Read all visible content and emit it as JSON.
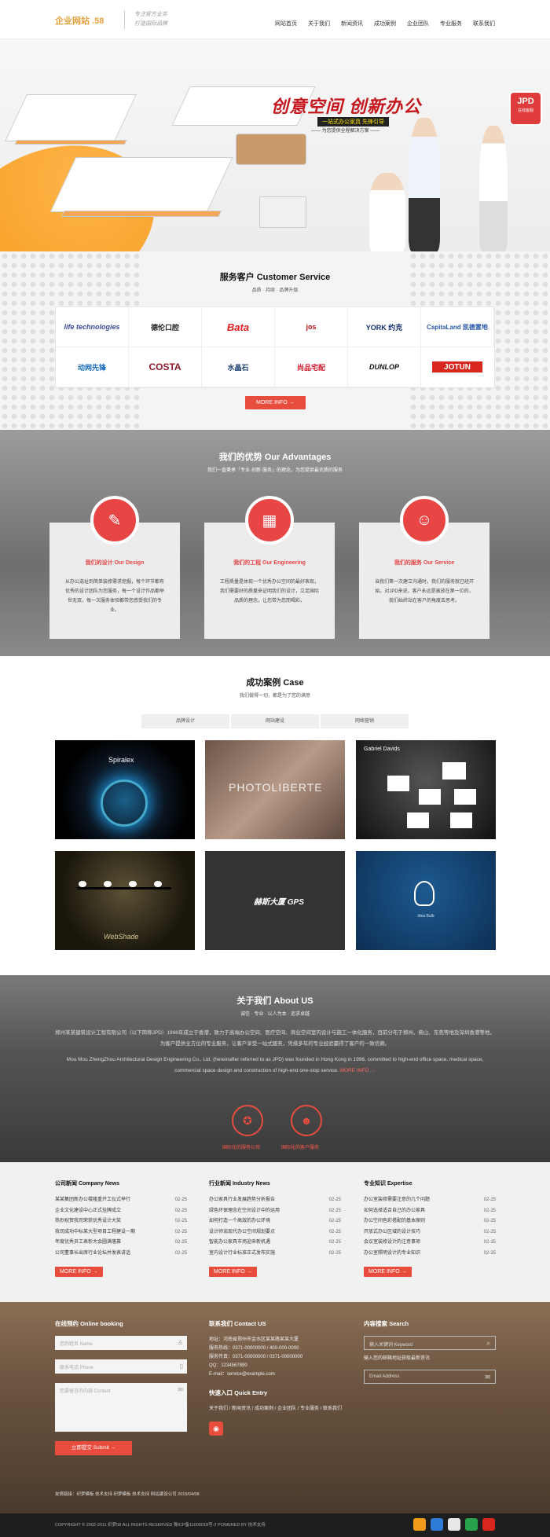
{
  "header": {
    "logo": "企业网站 .58",
    "slogan_line1": "专注官方业务",
    "slogan_line2": "打造国际品牌",
    "nav": [
      "网站首页",
      "关于我们",
      "新闻资讯",
      "成功案例",
      "企业团队",
      "专业服务",
      "联系我们"
    ]
  },
  "banner": {
    "title": "创意空间 创新办公",
    "sub1": "一站式办公家具 先锋引导",
    "sub2": "—— 为您提供全程解决方案 ——",
    "badge": "JPD",
    "badge_sub": "在线客服"
  },
  "customers": {
    "title": "服务客户 Customer Service",
    "subtitle": "品质 · 持续 · 品牌升级",
    "logos": [
      "life technologies",
      "德伦口腔",
      "Bata",
      "jos",
      "YORK 约克",
      "CapitaLand 凯德置地",
      "动网先锋",
      "COSTA",
      "水晶石",
      "尚品宅配",
      "DUNLOP",
      "JOTUN"
    ],
    "more": "MORE INFO →"
  },
  "advantages": {
    "title": "我们的优势 Our Advantages",
    "subtitle": "我们一直秉承「专业·创新·服务」的理念，为您提供最优质的服务",
    "cards": [
      {
        "title": "我们的设计 Our Design",
        "text": "从办公选址到简单装修需求挖掘，每个环节都有优秀的设计团队为您服务，每一个设计作品都举世无双，每一次服务体验都带您感受我们的专业。"
      },
      {
        "title": "我们的工程 Our Engineering",
        "text": "工程质量是体现一个优秀办公空间的最好表现，我们需要好的质量来证明我们的设计，立足国际品质的理念，让您带为您而喝彩。"
      },
      {
        "title": "我们的服务 Our Service",
        "text": "当我们第一次建立沟通时，我们的服务就已经开始，对JPD来说，客户永远是被放在第一位的，我们始终站在客户的角度去思考。"
      }
    ]
  },
  "case": {
    "title": "成功案例 Case",
    "subtitle": "我们做得一切，都是为了您的满意",
    "tabs": [
      "品牌设计",
      "网站建设",
      "网络营销"
    ],
    "items": [
      "Spiralex",
      "PHOTOLIBERTE",
      "Gabriel Davids",
      "WebShade",
      "赫斯大厦 GPS",
      "Idea Bulb"
    ]
  },
  "about": {
    "title": "关于我们 About US",
    "subtitle": "诚信 · 专业 · 以人为本 · 追求卓越",
    "p1": "郑州某某建筑设计工程有限公司（以下简称JPD）1996年成立于香港，致力于高端办公空间、医疗空间、商业空间室内设计与施工一体化服务，目前分布于郑州、佛山、东莞等地及深圳香港等地，为客户提供全方位的专业服务，让客户享受一站式服务，凭借多年的专业经验赢得了客户的一致信赖。",
    "p2": "Mou Mou ZhengZhou Architectural Design Engineering Co., Ltd. (hereinafter referred to as JPD) was founded in Hong Kong in 1996, committed to high-end office space, medical space, commercial space design and construction of high-end one-stop service.",
    "p2_link": "MORE INFO →",
    "icon1": "国际化的服务公司",
    "icon2": "国际化的客户服务"
  },
  "news": {
    "cols": [
      {
        "title": "公司新闻 Company News",
        "items": [
          [
            "某某集团新办公楼隆重开工仪式举行",
            "02-25"
          ],
          [
            "企业文化建设中心正式挂牌成立",
            "02-25"
          ],
          [
            "热烈祝贺我司荣获优秀设计大奖",
            "02-25"
          ],
          [
            "我司成功中标某大型项目工程建设一期",
            "02-25"
          ],
          [
            "年度优秀员工表彰大会圆满落幕",
            "02-25"
          ],
          [
            "公司董事长出席行业论坛并发表讲话",
            "02-25"
          ]
        ]
      },
      {
        "title": "行业新闻 Industry News",
        "items": [
          [
            "办公家具行业发展趋势分析报告",
            "02-25"
          ],
          [
            "绿色环保理念在空间设计中的运用",
            "02-25"
          ],
          [
            "如何打造一个高效的办公环境",
            "02-25"
          ],
          [
            "设计师谈现代办公空间规划要点",
            "02-25"
          ],
          [
            "智能办公家具市场迎来新机遇",
            "02-25"
          ],
          [
            "室内设计行业标准正式发布实施",
            "02-25"
          ]
        ]
      },
      {
        "title": "专业知识 Expertise",
        "items": [
          [
            "办公室装修需要注意的几个问题",
            "02-25"
          ],
          [
            "如何选择适合自己的办公家具",
            "02-25"
          ],
          [
            "办公空间色彩搭配的基本原则",
            "02-25"
          ],
          [
            "开放式办公区域的设计技巧",
            "02-25"
          ],
          [
            "会议室装修设计的注意事项",
            "02-25"
          ],
          [
            "办公室照明设计的专业知识",
            "02-25"
          ]
        ]
      }
    ],
    "more": "MORE INFO →"
  },
  "footer": {
    "booking": {
      "title": "在线预约 Online booking",
      "name": "您的姓名 Name",
      "phone": "联系电话 Phone",
      "content": "您要留言的内容 Content",
      "submit": "立即提交 Submit →"
    },
    "contact": {
      "title": "联系我们 Contact US",
      "lines": [
        "地址：河南省郑州市金水区某某路某某大厦",
        "服务热线：0371-00000000 / 400-000-0000",
        "服务传真：0371-00000000 / 0371-00000000",
        "QQ：1234567890",
        "E-mail：service@example.com"
      ],
      "quick_title": "快速入口 Quick Entry",
      "quick": "关于我们 / 新闻资讯 / 成功案例 / 企业团队 / 专业服务 / 联系我们"
    },
    "search": {
      "title": "内容搜索 Search",
      "placeholder": "输入关键词 Keyword",
      "note": "输入您的邮箱地址获取最新资讯",
      "email": "Email Address"
    },
    "links": "友情链接：织梦模板  技术支持  织梦模板  技术支持  网站建设公司  2015/04/08"
  },
  "bottom": {
    "copy": "COPYRIGHT © 2002-2011 织梦58 ALL RIGHTS RESERVED 豫ICP备11000018号-2 POWERED BY 技术支持"
  },
  "colors": {
    "accent": "#e84c3d",
    "brand_orange": "#f39a1a",
    "dark": "#1e1e1e"
  }
}
